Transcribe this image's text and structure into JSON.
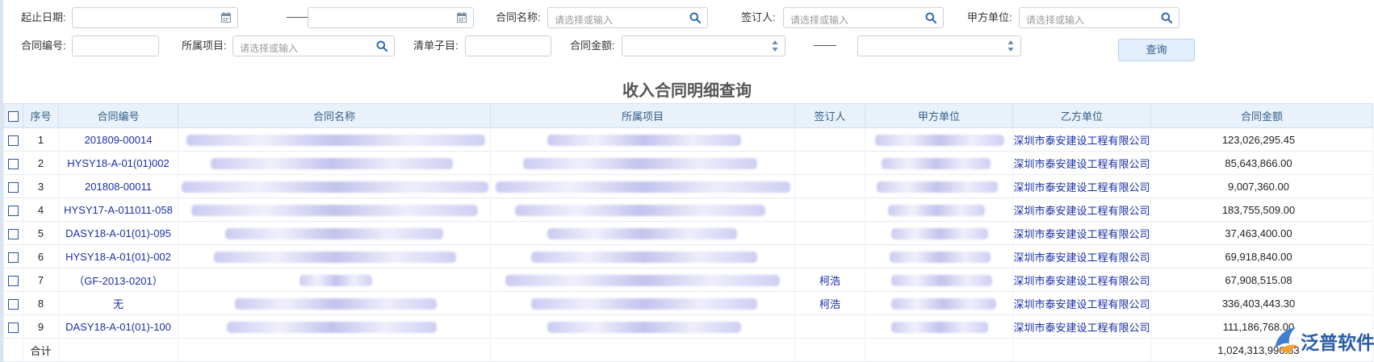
{
  "filters": {
    "start_date_label": "起止日期:",
    "date_separator": "——",
    "contract_name_label": "合同名称:",
    "contract_name_placeholder": "请选择或输入",
    "signer_label": "签订人:",
    "signer_placeholder": "请选择或输入",
    "party_a_label": "甲方单位:",
    "party_a_placeholder": "请选择或输入",
    "contract_no_label": "合同编号:",
    "project_label": "所属项目:",
    "project_placeholder": "请选择或输入",
    "bill_item_label": "清单子目:",
    "amount_label": "合同金额:",
    "amount_separator": "——",
    "query_button": "查询"
  },
  "title": "收入合同明细查询",
  "table": {
    "headers": {
      "index": "序号",
      "contract_no": "合同编号",
      "contract_name": "合同名称",
      "project": "所属项目",
      "signer": "签订人",
      "party_a": "甲方单位",
      "party_b": "乙方单位",
      "amount": "合同金额"
    },
    "rows": [
      {
        "index": "1",
        "contract_no": "201809-00014",
        "signer": "",
        "party_b": "深圳市泰安建设工程有限公司",
        "amount": "123,026,295.45"
      },
      {
        "index": "2",
        "contract_no": "HYSY18-A-01(01)002",
        "signer": "",
        "party_b": "深圳市泰安建设工程有限公司",
        "amount": "85,643,866.00"
      },
      {
        "index": "3",
        "contract_no": "201808-00011",
        "signer": "",
        "party_b": "深圳市泰安建设工程有限公司",
        "amount": "9,007,360.00"
      },
      {
        "index": "4",
        "contract_no": "HYSY17-A-011011-058",
        "signer": "",
        "party_b": "深圳市泰安建设工程有限公司",
        "amount": "183,755,509.00"
      },
      {
        "index": "5",
        "contract_no": "DASY18-A-01(01)-095",
        "signer": "",
        "party_b": "深圳市泰安建设工程有限公司",
        "amount": "37,463,400.00"
      },
      {
        "index": "6",
        "contract_no": "HYSY18-A-01(01)-002",
        "signer": "",
        "party_b": "深圳市泰安建设工程有限公司",
        "amount": "69,918,840.00"
      },
      {
        "index": "7",
        "contract_no": "（GF-2013-0201）",
        "signer": "柯浩",
        "party_b": "深圳市泰安建设工程有限公司",
        "amount": "67,908,515.08"
      },
      {
        "index": "8",
        "contract_no": "无",
        "signer": "柯浩",
        "party_b": "深圳市泰安建设工程有限公司",
        "amount": "336,403,443.30"
      },
      {
        "index": "9",
        "contract_no": "DASY18-A-01(01)-100",
        "signer": "",
        "party_b": "深圳市泰安建设工程有限公司",
        "amount": "111,186,768.00"
      }
    ],
    "total_label": "合计",
    "total_amount": "1,024,313,996.83"
  },
  "logo": {
    "text": "泛普软件"
  },
  "colors": {
    "link_blue": "#1a2fa8",
    "header_bg": "#e9f2fb",
    "icon_blue": "#2d6cb5"
  }
}
